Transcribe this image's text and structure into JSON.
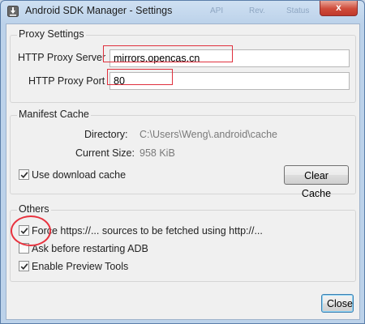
{
  "window": {
    "title": "Android SDK Manager - Settings",
    "close_label": "x",
    "background_hints": [
      "API",
      "Rev.",
      "Status"
    ]
  },
  "proxy": {
    "group_title": "Proxy Settings",
    "server_label": "HTTP Proxy Server",
    "server_value": "mirrors.opencas.cn",
    "port_label": "HTTP Proxy Port",
    "port_value": "80"
  },
  "manifest": {
    "group_title": "Manifest Cache",
    "directory_label": "Directory:",
    "directory_value": "C:\\Users\\Weng\\.android\\cache",
    "size_label": "Current Size:",
    "size_value": "958 KiB",
    "use_cache_label": "Use download cache",
    "use_cache_checked": true,
    "clear_button": "Clear Cache"
  },
  "others": {
    "group_title": "Others",
    "options": [
      {
        "label": "Force https://... sources to be fetched using http://...",
        "checked": true
      },
      {
        "label": "Ask before restarting ADB",
        "checked": false
      },
      {
        "label": "Enable Preview Tools",
        "checked": true
      }
    ]
  },
  "footer": {
    "close_button": "Close"
  },
  "colors": {
    "annotation_red": "#e0303d",
    "frame_blue": "#bcd2ea",
    "dialog_bg": "#f0f0f0"
  }
}
